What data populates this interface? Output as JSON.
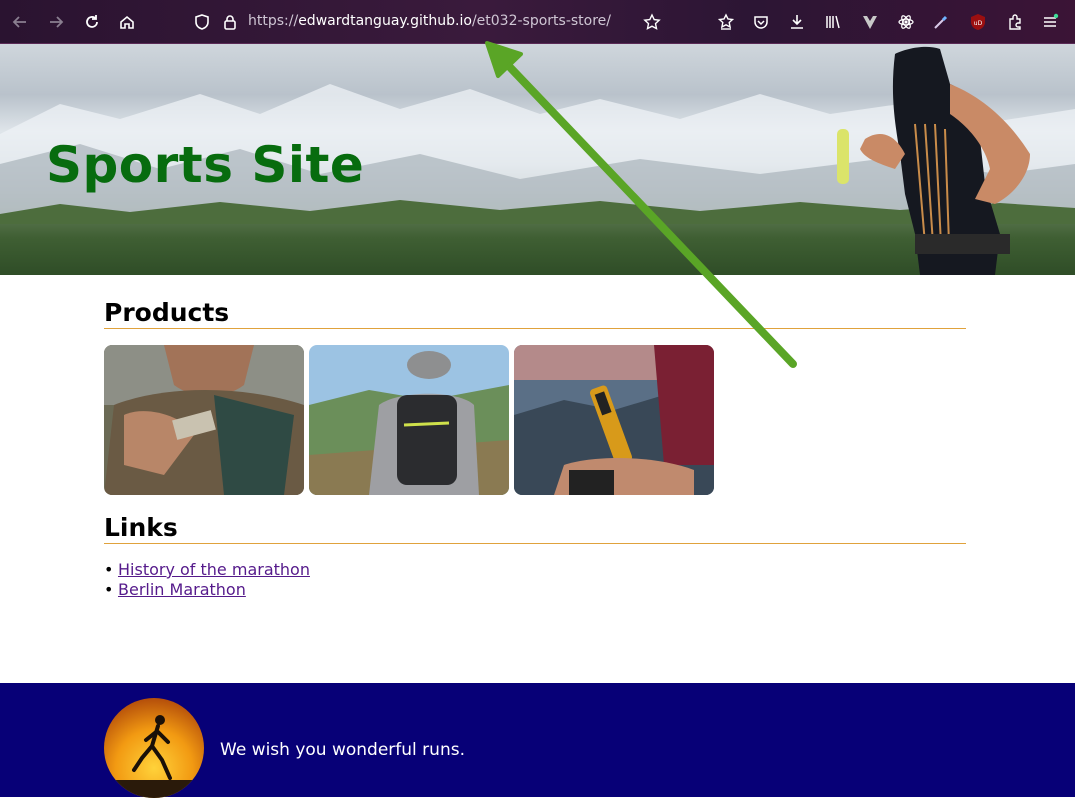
{
  "browser": {
    "url_prefix": "https://",
    "url_domain": "edwardtanguay.github.io",
    "url_path": "/et032-sports-store/"
  },
  "hero": {
    "title": "Sports Site"
  },
  "products": {
    "heading": "Products",
    "items": [
      {
        "image": "runner-eating-gel-photo"
      },
      {
        "image": "hiker-with-hydration-pack-photo"
      },
      {
        "image": "gps-watch-mountains-photo"
      }
    ]
  },
  "links": {
    "heading": "Links",
    "bullet": "•",
    "items": [
      {
        "label": "History of the marathon"
      },
      {
        "label": "Berlin Marathon"
      }
    ]
  },
  "footer": {
    "message": "We wish you wonderful runs."
  },
  "colors": {
    "title_green": "#076c0e",
    "heading_rule": "#e0a23c",
    "link_visited": "#551a8b",
    "footer_bg": "#070077",
    "arrow_green": "#5aa526"
  }
}
